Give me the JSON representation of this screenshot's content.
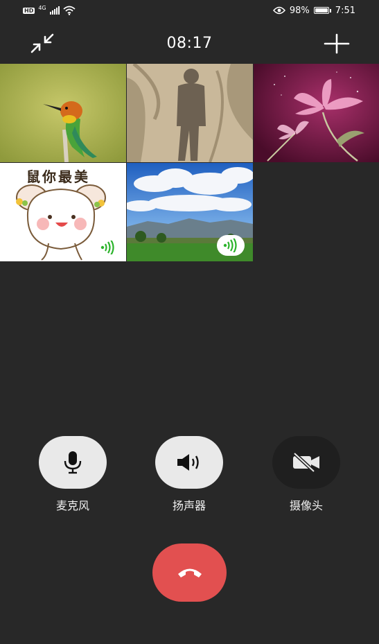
{
  "status_bar": {
    "hd": "HD",
    "network_type": "4G",
    "battery_percent": "98%",
    "time": "7:51",
    "icons": [
      "signal-icon",
      "wifi-icon",
      "eye-icon",
      "battery-icon"
    ]
  },
  "call": {
    "elapsed": "08:17",
    "participants": [
      {
        "tile": "bird-avatar",
        "speaking": false
      },
      {
        "tile": "shadow-avatar",
        "speaking": false
      },
      {
        "tile": "flower-avatar",
        "speaking": false
      },
      {
        "tile": "mouse-sticker-avatar",
        "caption": "鼠你最美",
        "speaking": true
      },
      {
        "tile": "landscape-avatar",
        "speaking": true
      }
    ]
  },
  "controls": {
    "mic_label": "麦克风",
    "speaker_label": "扬声器",
    "camera_label": "摄像头"
  },
  "colors": {
    "background": "#282828",
    "button_light": "#e9e9e9",
    "button_dark": "#1f1f1f",
    "hangup": "#e25050",
    "speaking_green": "#2bb32b"
  }
}
